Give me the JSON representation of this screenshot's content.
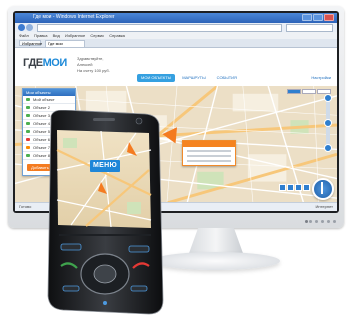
{
  "browser": {
    "window_title": "Где мои - Windows Internet Explorer",
    "menu": [
      "Файл",
      "Правка",
      "Вид",
      "Избранное",
      "Сервис",
      "Справка"
    ],
    "favorites_label": "Избранное",
    "tab_label": "Где мои"
  },
  "site": {
    "logo_main": "ГДЕ",
    "logo_accent": "МОИ",
    "login_lines": [
      "Здравствуйте,",
      "Алексей",
      "На счету 100 руб."
    ],
    "nav": [
      {
        "label": "МОИ ОБЪЕКТЫ",
        "active": true
      },
      {
        "label": "МАРШРУТЫ",
        "active": false
      },
      {
        "label": "СОБЫТИЯ",
        "active": false
      }
    ],
    "header_right": "Настройки"
  },
  "panel": {
    "title": "Мои объекты",
    "rows": [
      {
        "label": "Мой объект",
        "color": "green"
      },
      {
        "label": "Объект 2",
        "color": "green"
      },
      {
        "label": "Объект 3",
        "color": "green"
      },
      {
        "label": "Объект 4",
        "color": "green"
      },
      {
        "label": "Объект 5",
        "color": "green"
      },
      {
        "label": "Объект 6",
        "color": "red"
      },
      {
        "label": "Объект 7",
        "color": "orange"
      },
      {
        "label": "Объект 8",
        "color": "green"
      },
      {
        "label": "Объект 9",
        "color": "green"
      },
      {
        "label": "Объект 10",
        "color": "green"
      }
    ],
    "button_label": "Добавить"
  },
  "statusbar": {
    "left": "Готово",
    "right": "Интернет"
  },
  "phone": {
    "screen_label": "МЕНЮ"
  },
  "colors": {
    "accent_blue": "#1e86d8",
    "accent_orange": "#f47b20",
    "map_bg": "#e9dcc3"
  }
}
